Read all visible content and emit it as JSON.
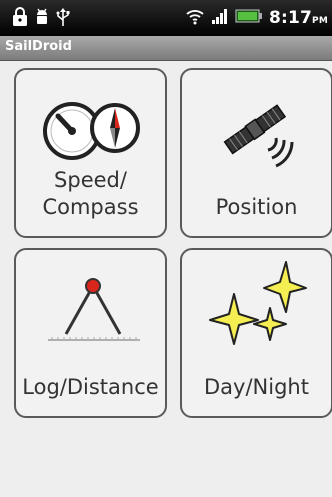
{
  "status_bar": {
    "time": "8:17",
    "ampm": "PM",
    "icons": [
      "lock-icon",
      "android-debug-icon",
      "usb-icon",
      "wifi-icon",
      "signal-icon",
      "battery-icon"
    ]
  },
  "app": {
    "title": "SailDroid"
  },
  "tiles": [
    {
      "label_line1": "Speed/",
      "label_line2": "Compass",
      "icon": "speedometer-compass-icon"
    },
    {
      "label": "Position",
      "icon": "satellite-icon"
    },
    {
      "label": "Log/Distance",
      "icon": "dividers-icon"
    },
    {
      "label": "Day/Night",
      "icon": "stars-icon"
    }
  ],
  "colors": {
    "status_bar": "#000000",
    "title_bar": "#8f8f8f",
    "background": "#eeeeee",
    "star_fill": "#f4ee52",
    "compass_red": "#d9261c"
  }
}
